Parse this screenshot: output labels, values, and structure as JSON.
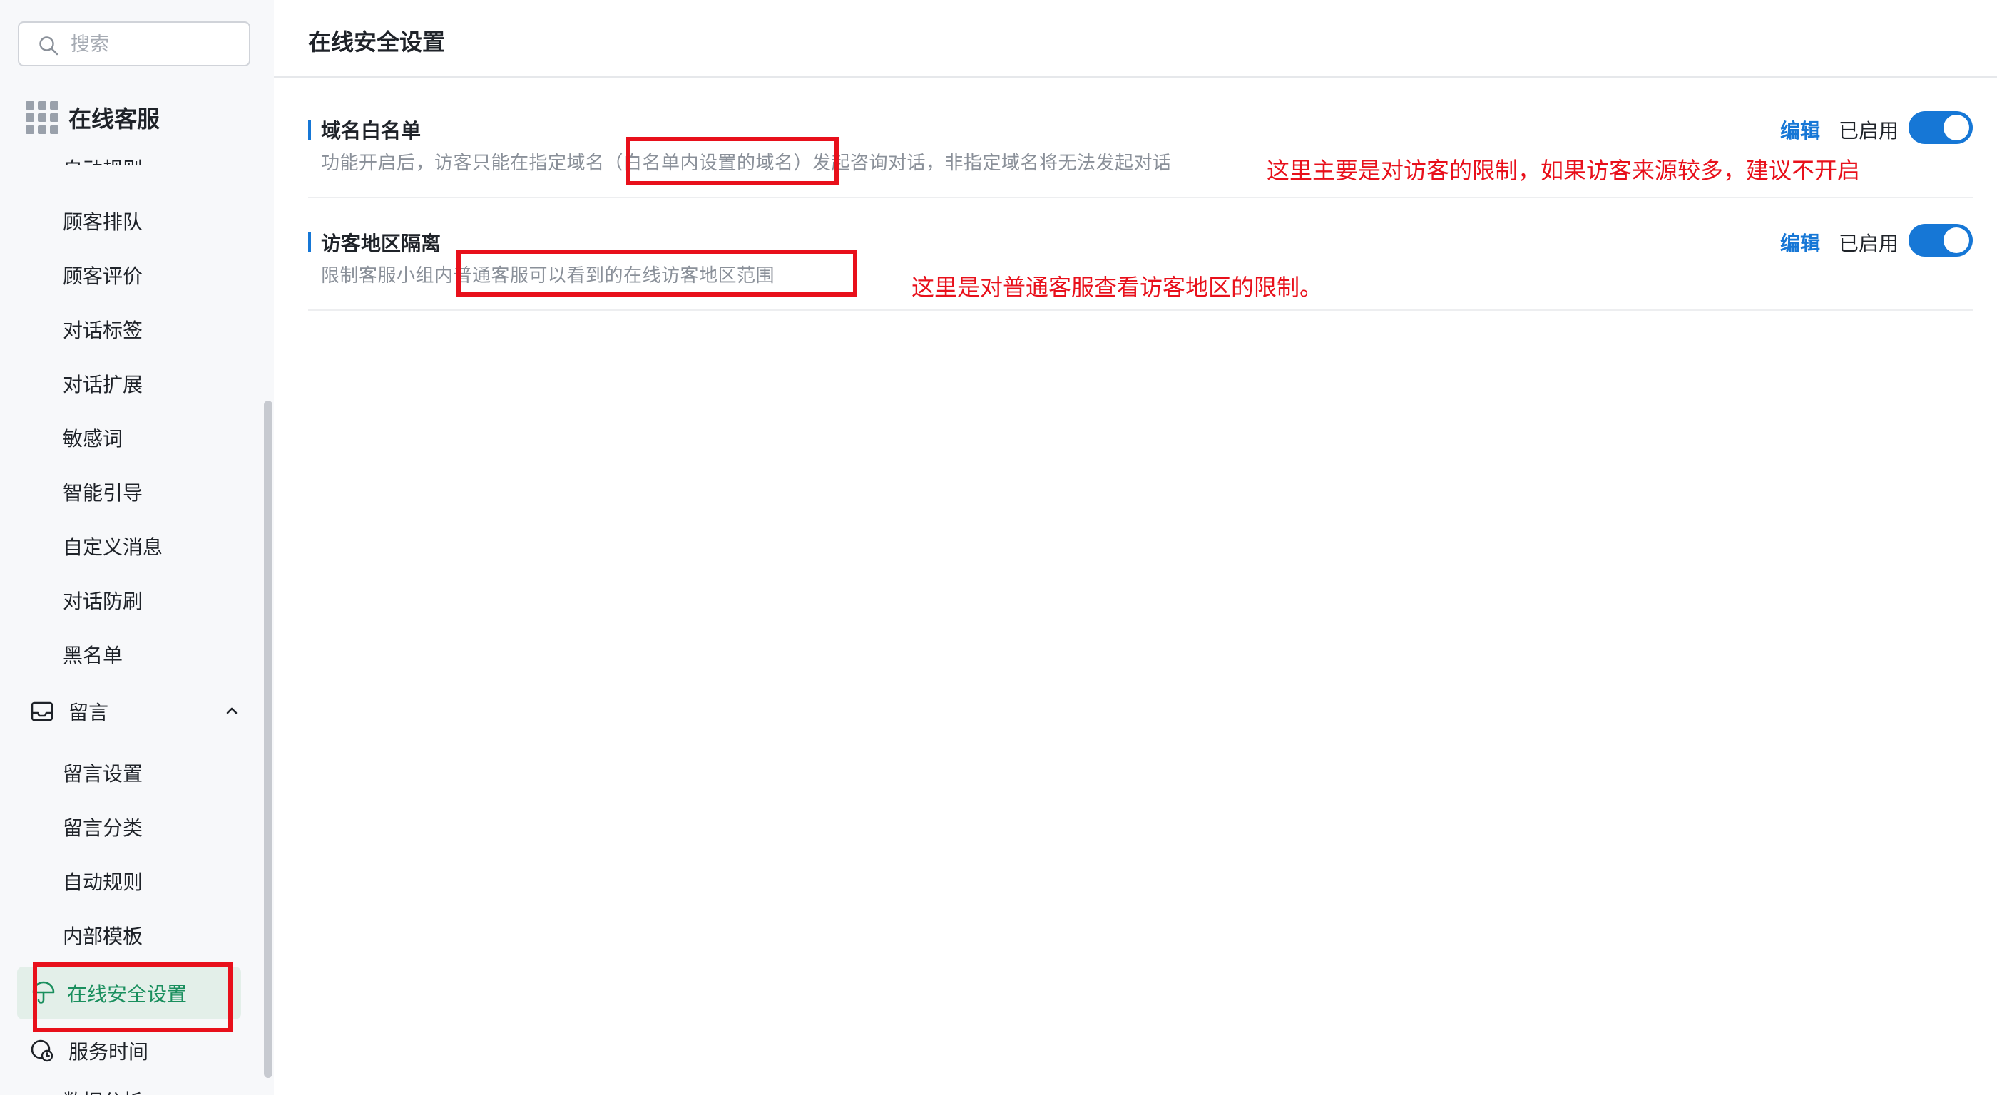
{
  "search": {
    "placeholder": "搜索"
  },
  "sidebar": {
    "module_title": "在线客服",
    "partial_top_item": "自动规则",
    "items": [
      {
        "label": "顾客排队"
      },
      {
        "label": "顾客评价"
      },
      {
        "label": "对话标签"
      },
      {
        "label": "对话扩展"
      },
      {
        "label": "敏感词"
      },
      {
        "label": "智能引导"
      },
      {
        "label": "自定义消息"
      },
      {
        "label": "对话防刷"
      },
      {
        "label": "黑名单"
      }
    ],
    "group": {
      "label": "留言",
      "expanded": true,
      "items": [
        {
          "label": "留言设置"
        },
        {
          "label": "留言分类"
        },
        {
          "label": "自动规则"
        },
        {
          "label": "内部模板"
        }
      ]
    },
    "active_item": {
      "label": "在线安全设置"
    },
    "service_item": {
      "label": "服务时间"
    },
    "partial_bottom_item": "数据分析"
  },
  "main": {
    "title": "在线安全设置",
    "settings": [
      {
        "name": "域名白名单",
        "description": "功能开启后，访客只能在指定域名（白名单内设置的域名）发起咨询对话，非指定域名将无法发起对话",
        "edit_label": "编辑",
        "status_label": "已启用",
        "enabled": true
      },
      {
        "name": "访客地区隔离",
        "description": "限制客服小组内普通客服可以看到的在线访客地区范围",
        "edit_label": "编辑",
        "status_label": "已启用",
        "enabled": true
      }
    ]
  },
  "annotations": {
    "note_1": "这里主要是对访客的限制，如果访客来源较多，建议不开启",
    "note_2": "这里是对普通客服查看访客地区的限制。"
  },
  "colors": {
    "accent_blue": "#1677d6",
    "active_green": "#1a8f5e",
    "active_bg": "#e3efe9",
    "annotation_red": "#e8101b"
  },
  "icons": {
    "search": "search-icon",
    "module": "grid-icon",
    "group": "inbox-icon",
    "group_toggle": "chevron-up-icon",
    "active": "umbrella-icon",
    "service": "clock-icon"
  }
}
